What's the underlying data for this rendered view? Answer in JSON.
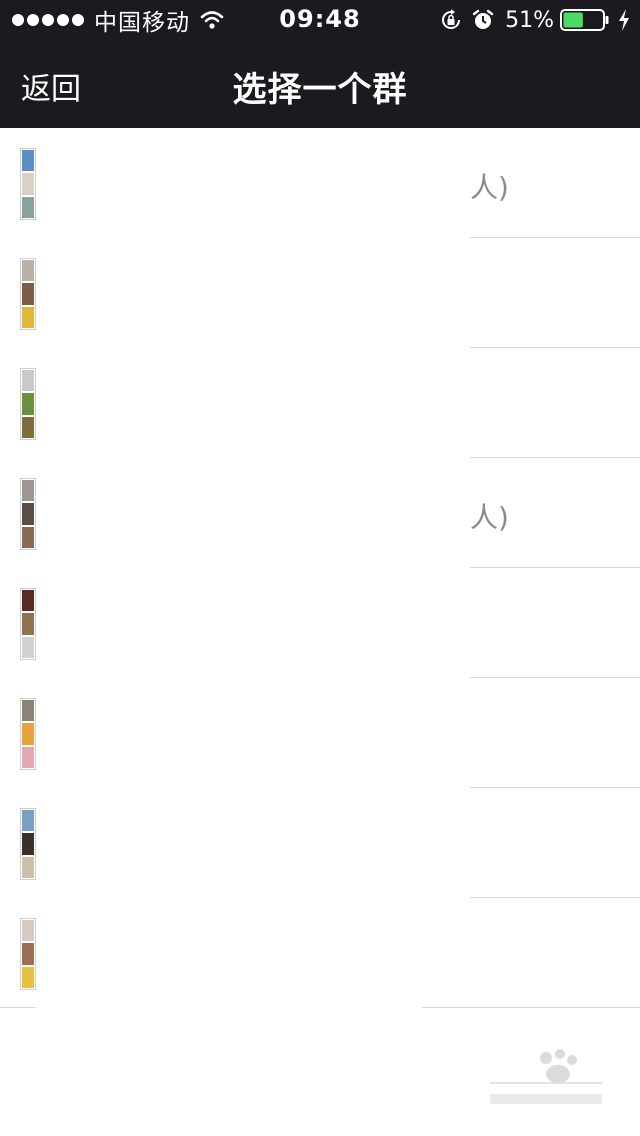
{
  "status_bar": {
    "carrier": "中国移动",
    "time": "09:48",
    "battery": "51%",
    "battery_level": 0.51
  },
  "nav": {
    "back_label": "返回",
    "title": "选择一个群"
  },
  "groups": [
    {
      "tail": "人)",
      "avatar_colors": [
        "#5a8fc4",
        "#d9d2c4",
        "#8aa39a"
      ]
    },
    {
      "tail": "",
      "avatar_colors": [
        "#b7b1a8",
        "#7d5b46",
        "#e2b636"
      ]
    },
    {
      "tail": "",
      "avatar_colors": [
        "#c9c9c9",
        "#6c8f3d",
        "#806b3c"
      ]
    },
    {
      "tail": "人)",
      "avatar_colors": [
        "#9d9792",
        "#5b4e44",
        "#8a6a52"
      ]
    },
    {
      "tail": "",
      "avatar_colors": [
        "#5a2a23",
        "#90724f",
        "#d0d0d0"
      ]
    },
    {
      "tail": "",
      "avatar_colors": [
        "#8a8476",
        "#e8a23b",
        "#e3a8b2"
      ]
    },
    {
      "tail": "",
      "avatar_colors": [
        "#7aa0c6",
        "#3b2f2a",
        "#cdbfa9"
      ]
    },
    {
      "tail": "",
      "avatar_colors": [
        "#d6c9c2",
        "#9c6f52",
        "#e6c13e"
      ]
    }
  ],
  "colors": {
    "bar_background": "#1b1a1f",
    "battery_fill": "#4cd964",
    "tail_text": "#8a8a8a"
  },
  "icons": {
    "wifi": "wifi-icon",
    "rotation_lock": "rotation-lock-icon",
    "alarm": "alarm-icon",
    "battery": "battery-icon",
    "charging": "charging-bolt-icon"
  }
}
